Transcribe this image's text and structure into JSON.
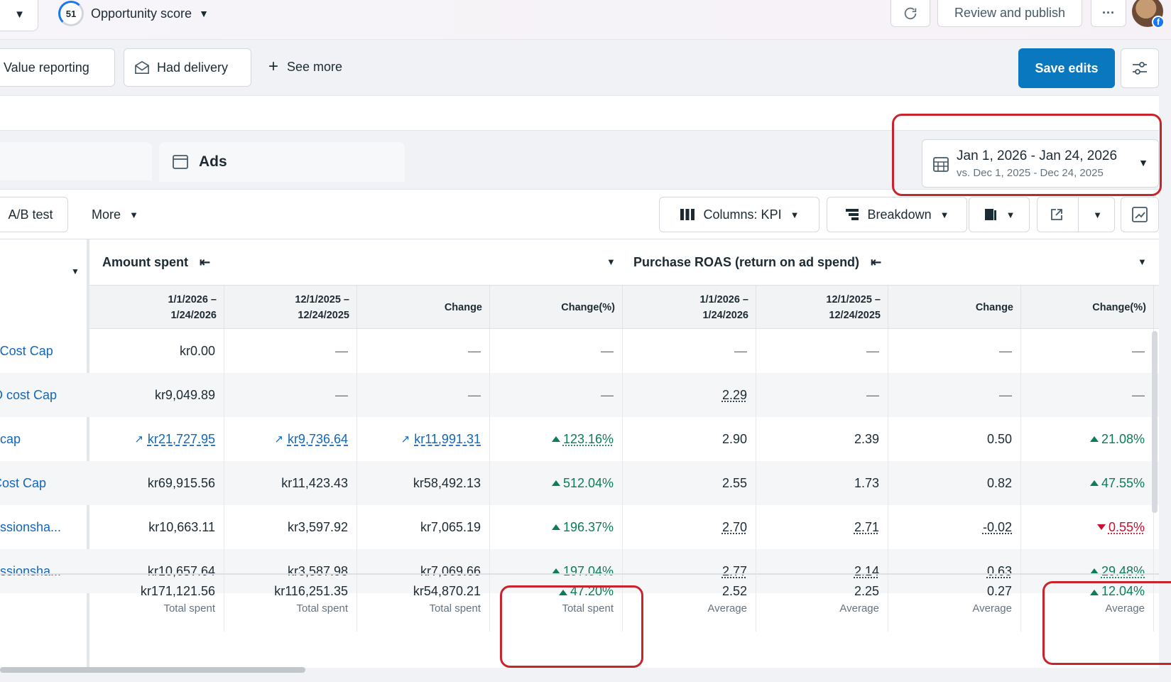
{
  "topbar": {
    "score": "51",
    "score_label": "Opportunity score",
    "review_label": "Review and publish",
    "more_label": "···"
  },
  "filters": {
    "chips": [
      "Value reporting",
      "Had delivery"
    ],
    "see_more": "See more",
    "save_label": "Save edits"
  },
  "level_tabs": {
    "ads": "Ads"
  },
  "date_range": {
    "main": "Jan 1, 2026 - Jan 24, 2026",
    "compare": "vs. Dec 1, 2025 - Dec 24, 2025"
  },
  "toolbar": {
    "ab_test": "A/B test",
    "more": "More",
    "columns": "Columns: KPI",
    "breakdown": "Breakdown"
  },
  "table": {
    "groups": [
      "Amount spent",
      "Purchase ROAS (return on ad spend)"
    ],
    "columns": [
      "1/1/2026 –\n1/24/2026",
      "12/1/2025 –\n12/24/2025",
      "Change",
      "Change(%)",
      "1/1/2026 –\n1/24/2026",
      "12/1/2025 –\n12/24/2025",
      "Change",
      "Change(%)"
    ],
    "rows": [
      {
        "name": "| Cost Cap",
        "cells": [
          "kr0.00",
          "—",
          "—",
          "—",
          "—",
          "—",
          "—",
          "—"
        ]
      },
      {
        "name": "O cost Cap",
        "cells": [
          "kr9,049.89",
          "—",
          "—",
          "—",
          "2.29",
          "—",
          "—",
          "—"
        ]
      },
      {
        "name": "t cap",
        "cells": [
          "kr21,727.95",
          "kr9,736.64",
          "kr11,991.31",
          "123.16%",
          "2.90",
          "2.39",
          "0.50",
          "21.08%"
        ]
      },
      {
        "name": "Cost Cap",
        "cells": [
          "kr69,915.56",
          "kr11,423.43",
          "kr58,492.13",
          "512.04%",
          "2.55",
          "1.73",
          "0.82",
          "47.55%"
        ]
      },
      {
        "name": "essionsha...",
        "cells": [
          "kr10,663.11",
          "kr3,597.92",
          "kr7,065.19",
          "196.37%",
          "2.70",
          "2.71",
          "-0.02",
          "0.55%"
        ]
      },
      {
        "name": "essionsha...",
        "cells": [
          "kr10,657.64",
          "kr3,587.98",
          "kr7,069.66",
          "197.04%",
          "2.77",
          "2.14",
          "0.63",
          "29.48%"
        ]
      }
    ],
    "totals": [
      {
        "v": "kr171,121.56",
        "l": "Total spent"
      },
      {
        "v": "kr116,251.35",
        "l": "Total spent"
      },
      {
        "v": "kr54,870.21",
        "l": "Total spent"
      },
      {
        "v": "47.20%",
        "l": "Total spent"
      },
      {
        "v": "2.52",
        "l": "Average"
      },
      {
        "v": "2.25",
        "l": "Average"
      },
      {
        "v": "0.27",
        "l": "Average"
      },
      {
        "v": "12.04%",
        "l": "Average"
      }
    ]
  },
  "colors": {
    "accent": "#0a78be",
    "positive": "#0e7c55",
    "negative": "#c8102e",
    "highlight": "#c9242b"
  }
}
